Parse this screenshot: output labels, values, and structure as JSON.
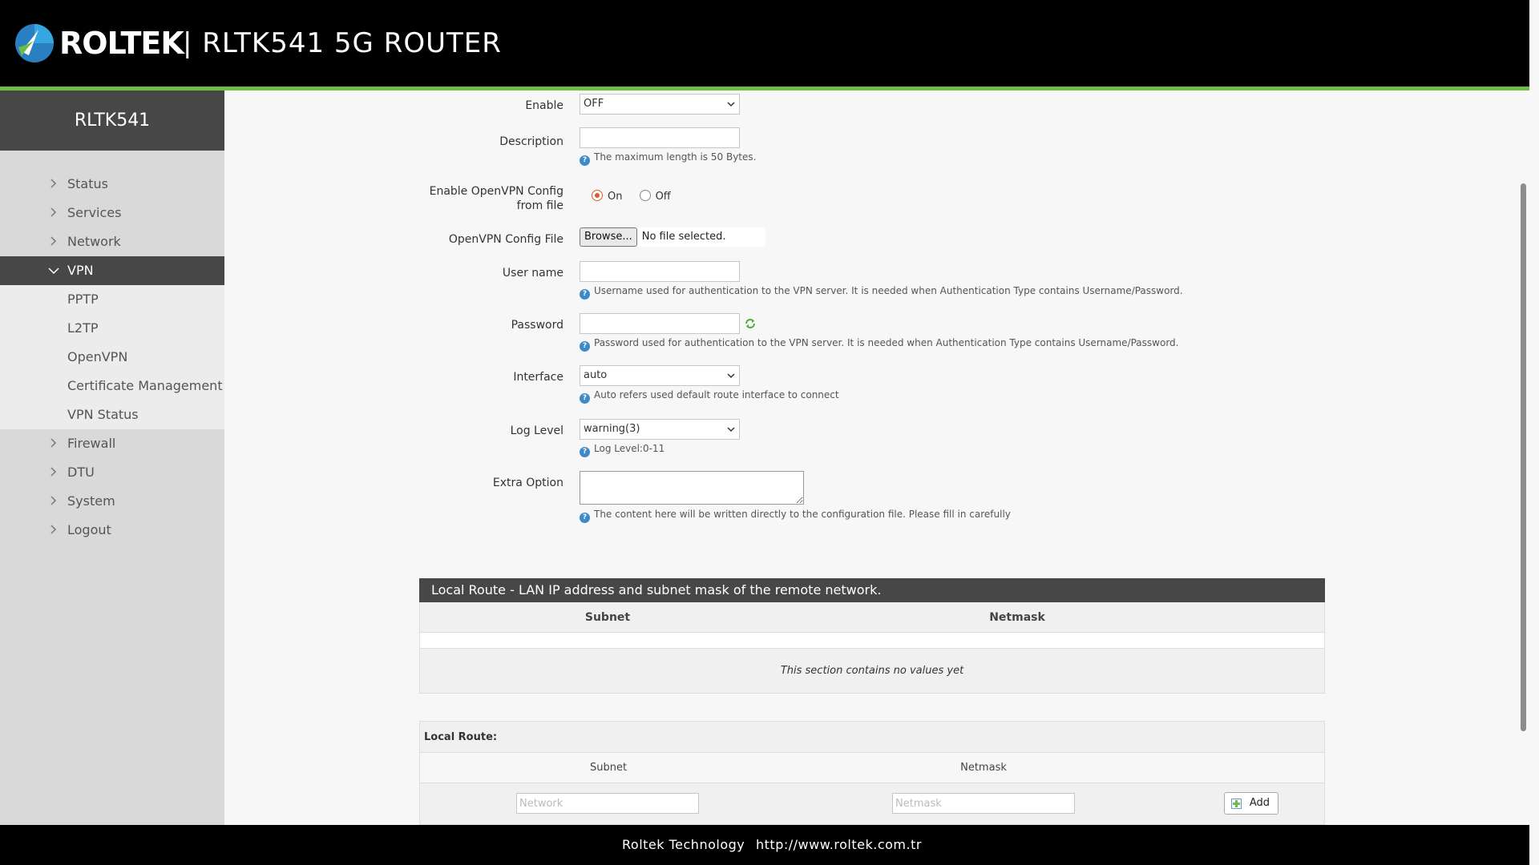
{
  "header": {
    "brand": "ROLTEK",
    "model_title": "| RLTK541  5G  ROUTER"
  },
  "sidebar": {
    "title": "RLTK541",
    "items": [
      {
        "label": "Status"
      },
      {
        "label": "Services"
      },
      {
        "label": "Network"
      },
      {
        "label": "VPN"
      },
      {
        "label": "Firewall"
      },
      {
        "label": "DTU"
      },
      {
        "label": "System"
      },
      {
        "label": "Logout"
      }
    ],
    "vpn_sub": [
      {
        "label": "PPTP"
      },
      {
        "label": "L2TP"
      },
      {
        "label": "OpenVPN"
      },
      {
        "label": "Certificate Management"
      },
      {
        "label": "VPN Status"
      }
    ]
  },
  "form": {
    "enable": {
      "label": "Enable",
      "value": "OFF"
    },
    "description": {
      "label": "Description",
      "hint": "The maximum length is 50 Bytes."
    },
    "config_from_file": {
      "label": "Enable OpenVPN Config from file",
      "on_label": "On",
      "off_label": "Off",
      "selected": "On"
    },
    "config_file": {
      "label": "OpenVPN Config File",
      "browse_label": "Browse...",
      "file_status": "No file selected."
    },
    "username": {
      "label": "User name",
      "hint": "Username used for authentication to the VPN server. It is needed when Authentication Type contains Username/Password."
    },
    "password": {
      "label": "Password",
      "hint": "Password used for authentication to the VPN server. It is needed when Authentication Type contains Username/Password."
    },
    "interface": {
      "label": "Interface",
      "value": "auto",
      "hint": "Auto refers used default route interface to connect"
    },
    "log_level": {
      "label": "Log Level",
      "value": "warning(3)",
      "hint": "Log Level:0-11"
    },
    "extra_option": {
      "label": "Extra Option",
      "hint": "The content here will be written directly to the configuration file. Please fill in carefully"
    }
  },
  "local_route_table": {
    "title": "Local Route - LAN IP address and subnet mask of the remote network.",
    "columns": [
      "Subnet",
      "Netmask"
    ],
    "empty_text": "This section contains no values yet"
  },
  "local_route_add": {
    "title": "Local Route:",
    "columns": [
      "Subnet",
      "Netmask"
    ],
    "subnet_placeholder": "Network",
    "netmask_placeholder": "Netmask",
    "add_label": "Add"
  },
  "footer": {
    "company": "Roltek Technology",
    "url": "http://www.roltek.com.tr"
  },
  "colors": {
    "accent_green": "#6cbd45",
    "header_bg": "#000000",
    "sidebar_active": "#474747",
    "radio_selected": "#e05a2b",
    "help_icon": "#3d8ac7"
  }
}
